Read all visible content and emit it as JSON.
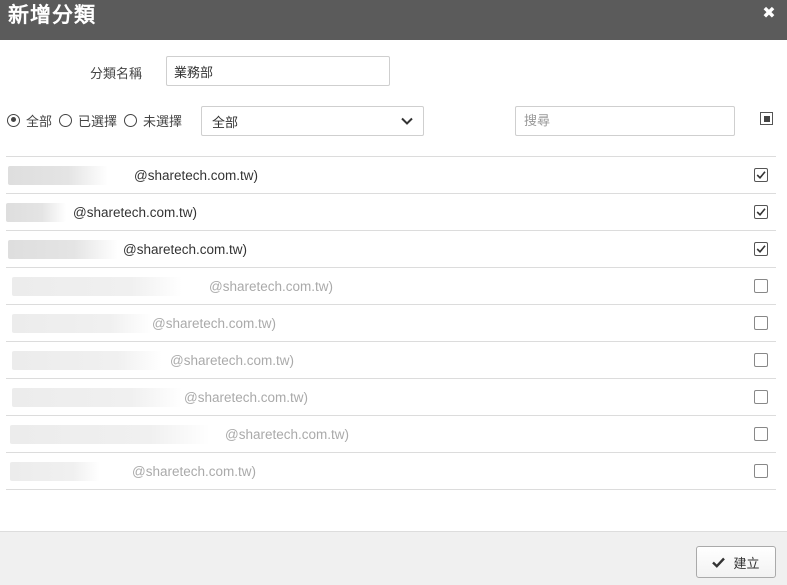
{
  "dialog": {
    "title": "新增分類",
    "close_icon": "close-icon"
  },
  "form": {
    "name_label": "分類名稱",
    "name_value": "業務部",
    "filter": {
      "options": [
        "全部",
        "已選擇",
        "未選擇"
      ],
      "selected": "全部"
    },
    "group_select": {
      "value": "全部"
    },
    "search_placeholder": "搜尋"
  },
  "members": [
    {
      "email": "@sharetech.com.tw)",
      "checked": true
    },
    {
      "email": "@sharetech.com.tw)",
      "checked": true
    },
    {
      "email": "@sharetech.com.tw)",
      "checked": true
    },
    {
      "email": "@sharetech.com.tw)",
      "checked": false
    },
    {
      "email": "@sharetech.com.tw)",
      "checked": false
    },
    {
      "email": "@sharetech.com.tw)",
      "checked": false
    },
    {
      "email": "@sharetech.com.tw)",
      "checked": false
    },
    {
      "email": "@sharetech.com.tw)",
      "checked": false
    },
    {
      "email": "@sharetech.com.tw)",
      "checked": false
    }
  ],
  "footer": {
    "create_label": "建立",
    "create_icon": "check-icon"
  },
  "colors": {
    "titlebar": "#5b5b5b",
    "footer": "#f0f0f0"
  }
}
